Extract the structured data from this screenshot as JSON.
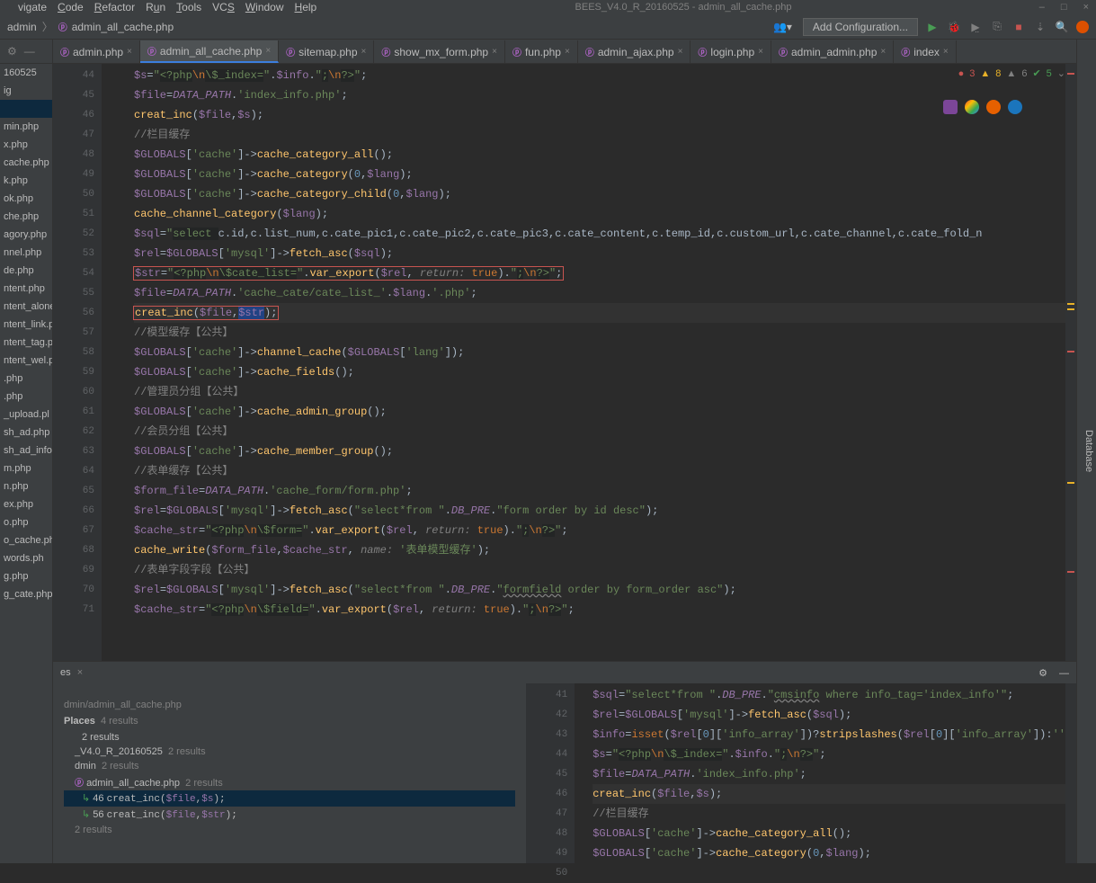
{
  "window": {
    "title": "BEES_V4.0_R_20160525 - admin_all_cache.php",
    "controls": [
      "–",
      "□",
      "×"
    ]
  },
  "menus": [
    "Navigate",
    "Code",
    "Refactor",
    "Run",
    "Tools",
    "VCS",
    "Window",
    "Help"
  ],
  "breadcrumb": {
    "items": [
      "admin",
      "admin_all_cache.php"
    ]
  },
  "toolbar": {
    "add_configuration": "Add Configuration..."
  },
  "right_sidebar": {
    "label": "Database"
  },
  "sidebar": {
    "top_label": "160525",
    "items": [
      "ig",
      "",
      "min.php",
      "x.php",
      "cache.php",
      "k.php",
      "ok.php",
      "che.php",
      "agory.php",
      "nnel.php",
      "de.php",
      "ntent.php",
      "ntent_alone",
      "ntent_link.p",
      "ntent_tag.p",
      "ntent_wel.p",
      ".php",
      ".php",
      "_upload.pl",
      "sh_ad.php",
      "sh_ad_info.",
      "m.php",
      "n.php",
      "ex.php",
      "o.php",
      "o_cache.ph",
      "words.ph",
      "g.php",
      "g_cate.php"
    ],
    "selected_index": 1
  },
  "tabs": [
    {
      "label": "admin.php",
      "active": false
    },
    {
      "label": "admin_all_cache.php",
      "active": true
    },
    {
      "label": "sitemap.php",
      "active": false
    },
    {
      "label": "show_mx_form.php",
      "active": false
    },
    {
      "label": "fun.php",
      "active": false
    },
    {
      "label": "admin_ajax.php",
      "active": false
    },
    {
      "label": "login.php",
      "active": false
    },
    {
      "label": "admin_admin.php",
      "active": false
    },
    {
      "label": "index"
    }
  ],
  "inspections": {
    "errors": "3",
    "warnings": "8",
    "weak": "6",
    "ok": "5"
  },
  "editor": {
    "first_line": 44,
    "current_line": 56
  },
  "bottom": {
    "tab_label": "es",
    "file_path": "dmin/admin_all_cache.php",
    "places_label": "Places",
    "places_count": "4 results",
    "groups": [
      {
        "label": "2 results"
      },
      {
        "label": "_V4.0_R_20160525",
        "count": "2 results"
      },
      {
        "label": "dmin",
        "count": "2 results"
      },
      {
        "label": "admin_all_cache.php",
        "count": "2 results"
      }
    ],
    "hits": [
      {
        "line": "46",
        "text": "creat_inc($file,$s);"
      },
      {
        "line": "56",
        "text": "creat_inc($file,$str);"
      }
    ],
    "right_first_line": 41,
    "right_current_line": 46
  }
}
